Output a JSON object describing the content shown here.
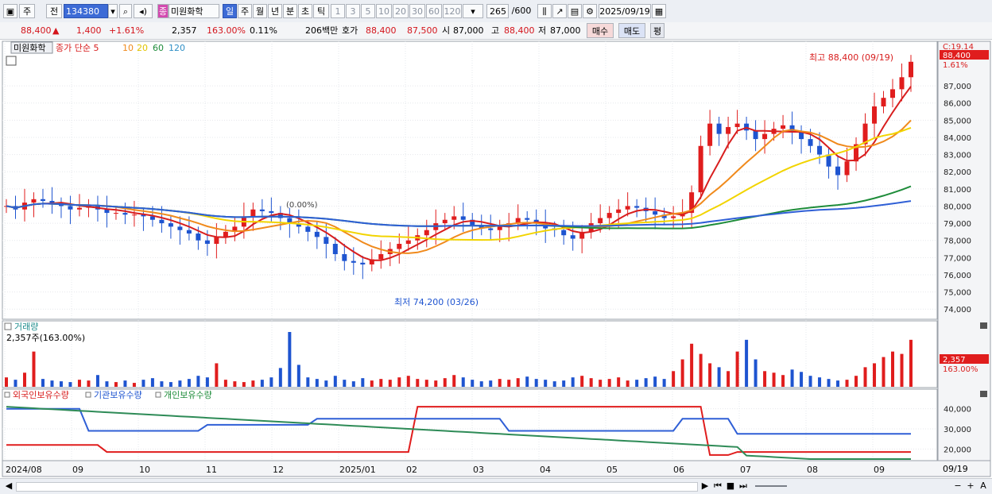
{
  "toolbar": {
    "market": "주",
    "prev": "전",
    "code": "134380",
    "jong_icon": "종",
    "stock_name": "미원화학",
    "periods": [
      "일",
      "주",
      "월",
      "년",
      "분",
      "초",
      "틱"
    ],
    "selected_period": "일",
    "intervals": [
      "1",
      "3",
      "5",
      "10",
      "20",
      "30",
      "60",
      "120"
    ],
    "count": "265",
    "count_total": "/600",
    "date": "2025/09/19"
  },
  "quote": {
    "price": "88,400",
    "change": "1,400",
    "change_pct": "+1.61%",
    "volume": "2,357",
    "volume_pct": "163.00%",
    "turnover": "0.11%",
    "amount": "206백만",
    "hoga_label": "호가",
    "ask": "88,400",
    "bid": "87,500",
    "open_label": "시",
    "open": "87,000",
    "high_label": "고",
    "high": "88,400",
    "low_label": "저",
    "low": "87,000",
    "buy_label": "매수",
    "sell_label": "매도",
    "eval_label": "평"
  },
  "chart_data": [
    {
      "type": "candlestick",
      "title": "미원화학",
      "legend": [
        "종가 단순 5",
        "10",
        "20",
        "60",
        "120"
      ],
      "legend_colors": [
        "#d81e1e",
        "#f08a1c",
        "#f2d400",
        "#1e8c3a",
        "#2f5fd6"
      ],
      "ylim": [
        73500,
        89500
      ],
      "y_ticks": [
        "74,000",
        "75,000",
        "76,000",
        "77,000",
        "78,000",
        "79,000",
        "80,000",
        "81,000",
        "82,000",
        "83,000",
        "84,000",
        "85,000",
        "86,000",
        "87,000"
      ],
      "price_tag": "88,400",
      "price_tag_pct": "1.61%",
      "corner_label": "C:19.14",
      "high_annotation": "최고 88,400 (09/19)",
      "low_annotation": "최저 74,200 (03/26)",
      "mid_annotation": "(0.00%)",
      "series": [
        {
          "name": "종가",
          "values": [
            80000,
            79800,
            80200,
            80400,
            80300,
            80100,
            80000,
            79800,
            79900,
            80000,
            79800,
            79600,
            79600,
            79500,
            79500,
            79400,
            79200,
            79000,
            78800,
            78600,
            78400,
            78000,
            77800,
            78200,
            78500,
            78800,
            79400,
            79800,
            79700,
            79600,
            79300,
            79000,
            78800,
            78500,
            78200,
            77800,
            77200,
            76800,
            76700,
            76600,
            76900,
            77200,
            77500,
            77800,
            78000,
            78300,
            78600,
            79000,
            79200,
            79400,
            79200,
            78900,
            78700,
            78600,
            78800,
            79000,
            79300,
            79200,
            79000,
            78700,
            78600,
            78300,
            78100,
            78500,
            79000,
            79300,
            79600,
            79800,
            80000,
            79900,
            79700,
            79500,
            79300,
            79400,
            79600,
            80800,
            83500,
            84800,
            84200,
            84600,
            84800,
            84400,
            83900,
            84200,
            84500,
            84700,
            84300,
            83900,
            83500,
            83000,
            82300,
            81800,
            82600,
            83600,
            84800,
            85800,
            86300,
            86800,
            87500,
            88400
          ]
        }
      ]
    },
    {
      "type": "bar",
      "title": "거래량",
      "subtitle": "2,357주(163.00%)",
      "tag_value": "2,357",
      "tag_pct": "163.00%",
      "values": [
        12,
        9,
        18,
        45,
        10,
        8,
        7,
        6,
        9,
        8,
        15,
        7,
        6,
        8,
        5,
        9,
        11,
        7,
        6,
        8,
        10,
        14,
        12,
        30,
        9,
        7,
        6,
        8,
        9,
        12,
        24,
        70,
        28,
        12,
        10,
        8,
        14,
        9,
        7,
        11,
        8,
        10,
        9,
        12,
        14,
        10,
        9,
        8,
        11,
        15,
        12,
        9,
        7,
        8,
        10,
        9,
        11,
        13,
        10,
        9,
        7,
        8,
        12,
        14,
        11,
        9,
        10,
        12,
        8,
        9,
        11,
        13,
        10,
        20,
        35,
        55,
        42,
        30,
        25,
        20,
        45,
        60,
        35,
        20,
        18,
        15,
        22,
        19,
        14,
        12,
        10,
        8,
        9,
        14,
        25,
        30,
        38,
        45,
        42,
        60
      ]
    },
    {
      "type": "line",
      "legend": [
        "외국인보유수량",
        "기관보유수량",
        "개인보유수량"
      ],
      "y_ticks": [
        "20,000",
        "30,000",
        "40,000"
      ],
      "ylim": [
        15000,
        45000
      ],
      "last_label": "09/19",
      "x_ticks": [
        "2024/08",
        "09",
        "10",
        "11",
        "12",
        "2025/01",
        "02",
        "03",
        "04",
        "05",
        "06",
        "07",
        "08",
        "09"
      ]
    }
  ],
  "bottom": {
    "nav_buttons": [
      "◀",
      "▶",
      "⏮",
      "■",
      "⏭"
    ],
    "zoom_labels": [
      "−",
      "+",
      "A"
    ]
  }
}
